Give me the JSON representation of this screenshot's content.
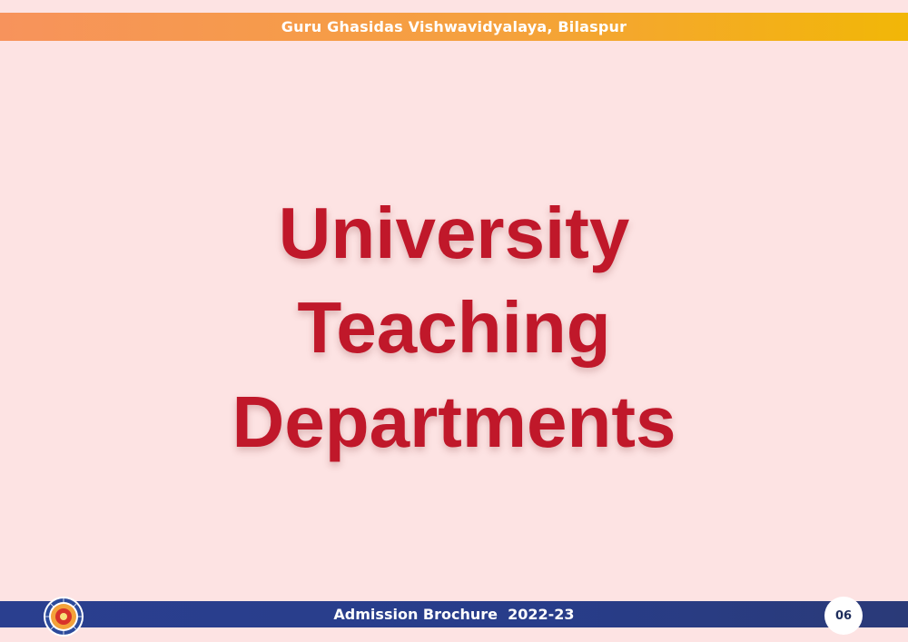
{
  "header": {
    "university": "Guru Ghasidas Vishwavidyalaya, Bilaspur"
  },
  "main": {
    "title_lines": [
      "University",
      "Teaching",
      "Departments"
    ]
  },
  "footer": {
    "brochure": "Admission Brochure  2022-23",
    "page_number": "06"
  },
  "colors": {
    "title": "#c0182a",
    "header_band_start": "#f7935c",
    "header_band_end": "#f2b707",
    "footer_band": "#2a3f8f",
    "background": "#fde3e3"
  },
  "icons": {
    "logo": "university-seal-icon"
  }
}
